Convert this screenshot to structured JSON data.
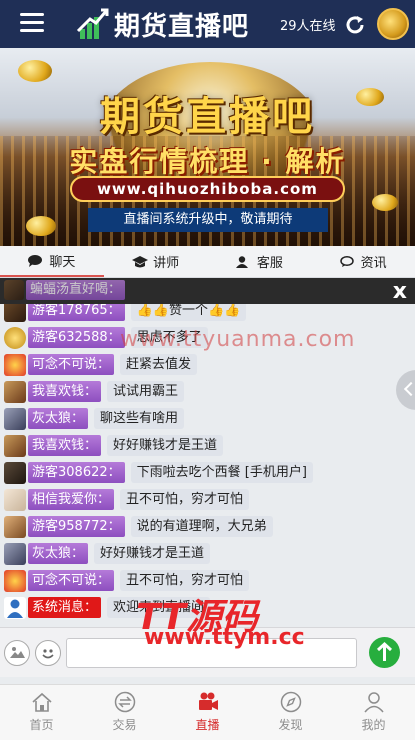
{
  "header": {
    "logo_text": "期货直播吧",
    "online_count": "29人在线"
  },
  "banner": {
    "title": "期货直播吧",
    "subtitle": "实盘行情梳理 · 解析",
    "url": "www.qihuozhiboba.com",
    "notice": "直播间系统升级中，敬请期待"
  },
  "tabs": [
    {
      "label": "聊天",
      "icon": "chat-icon",
      "active": true
    },
    {
      "label": "讲师",
      "icon": "graduation-cap-icon",
      "active": false
    },
    {
      "label": "客服",
      "icon": "user-icon",
      "active": false
    },
    {
      "label": "资讯",
      "icon": "comment-icon",
      "active": false
    }
  ],
  "announcement": {
    "partial_text": "蝙蝠汤直好喝：",
    "close_label": "x"
  },
  "messages": [
    {
      "name": "游客178765：",
      "text": "👍👍赞一个👍👍",
      "type": "guest"
    },
    {
      "name": "游客632588：",
      "text": "思虑不多了",
      "type": "guest"
    },
    {
      "name": "可念不可说：",
      "text": "赶紧去值发",
      "type": "guest"
    },
    {
      "name": "我喜欢钱：",
      "text": "试试用霸王",
      "type": "guest"
    },
    {
      "name": "灰太狼：",
      "text": "聊这些有啥用",
      "type": "guest"
    },
    {
      "name": "我喜欢钱：",
      "text": "好好赚钱才是王道",
      "type": "guest"
    },
    {
      "name": "游客308622：",
      "text": "下雨啦去吃个西餐 [手机用户]",
      "type": "guest"
    },
    {
      "name": "相信我爱你：",
      "text": "丑不可怕，穷才可怕",
      "type": "guest"
    },
    {
      "name": "游客958772：",
      "text": "说的有道理啊，大兄弟",
      "type": "guest"
    },
    {
      "name": "灰太狼：",
      "text": "好好赚钱才是王道",
      "type": "guest"
    },
    {
      "name": "可念不可说：",
      "text": "丑不可怕，穷才可怕",
      "type": "guest"
    },
    {
      "name": "系统消息：",
      "text": "欢迎来到直播间",
      "type": "system"
    }
  ],
  "watermarks": {
    "overlay_url": "www.ttyuanma.com",
    "brand": "TT源码",
    "brand_url": "www.ttym.cc"
  },
  "input": {
    "value": "",
    "placeholder": ""
  },
  "nav": [
    {
      "label": "首页",
      "icon": "home-icon",
      "active": false
    },
    {
      "label": "交易",
      "icon": "exchange-icon",
      "active": false
    },
    {
      "label": "直播",
      "icon": "video-camera-icon",
      "active": true
    },
    {
      "label": "发现",
      "icon": "compass-icon",
      "active": false
    },
    {
      "label": "我的",
      "icon": "person-icon",
      "active": false
    }
  ],
  "colors": {
    "header_bg": "#1f2f56",
    "name_tag": "#9b5fca",
    "system_tag": "#e01818",
    "send_button": "#27ae3e",
    "nav_active": "#d62c2c"
  }
}
